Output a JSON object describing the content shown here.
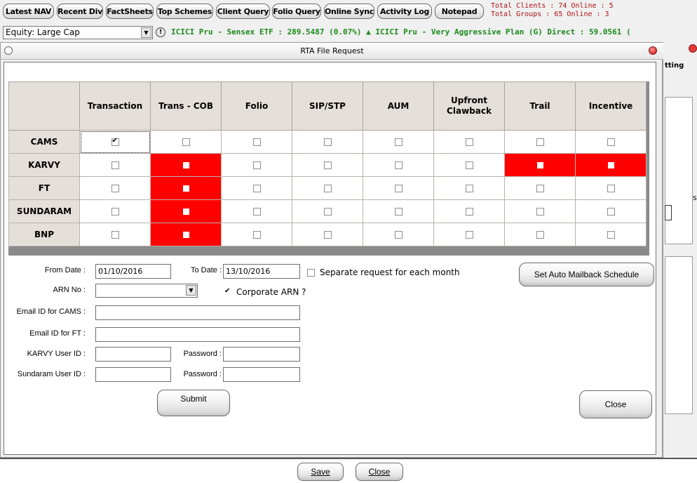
{
  "toolbar": {
    "buttons": [
      "Latest NAV",
      "Recent Div",
      "FactSheets",
      "Top Schemes",
      "Client Query",
      "Folio Query",
      "Online Sync",
      "Activity Log",
      "Notepad"
    ],
    "stats_line1": "Total Clients : 74 Online : 5",
    "stats_line2": "Total Groups : 65 Online : 3"
  },
  "category_select": {
    "value": "Equity: Large Cap"
  },
  "ticker": "ICICI Pru - Sensex ETF : 289.5487 (0.07%) ▲  ICICI Pru - Very Aggressive Plan (G) Direct : 59.0561 (",
  "dialog": {
    "title": "RTA File Request",
    "grid": {
      "columns": [
        "Transaction",
        "Trans - COB",
        "Folio",
        "SIP/STP",
        "AUM",
        "Upfront Clawback",
        "Trail",
        "Incentive"
      ],
      "rows": [
        {
          "name": "CAMS",
          "checked": [
            true,
            false,
            false,
            false,
            false,
            false,
            false,
            false
          ],
          "disabled": [
            false,
            false,
            false,
            false,
            false,
            false,
            false,
            false
          ]
        },
        {
          "name": "KARVY",
          "checked": [
            false,
            false,
            false,
            false,
            false,
            false,
            false,
            false
          ],
          "disabled": [
            false,
            true,
            false,
            false,
            false,
            false,
            true,
            true
          ]
        },
        {
          "name": "FT",
          "checked": [
            false,
            false,
            false,
            false,
            false,
            false,
            false,
            false
          ],
          "disabled": [
            false,
            true,
            false,
            false,
            false,
            false,
            false,
            false
          ]
        },
        {
          "name": "SUNDARAM",
          "checked": [
            false,
            false,
            false,
            false,
            false,
            false,
            false,
            false
          ],
          "disabled": [
            false,
            true,
            false,
            false,
            false,
            false,
            false,
            false
          ]
        },
        {
          "name": "BNP",
          "checked": [
            false,
            false,
            false,
            false,
            false,
            false,
            false,
            false
          ],
          "disabled": [
            false,
            true,
            false,
            false,
            false,
            false,
            false,
            false
          ]
        }
      ],
      "disabled_color": "#ff0000"
    },
    "form": {
      "from_date_label": "From Date :",
      "from_date": "01/10/2016",
      "to_date_label": "To Date :",
      "to_date": "13/10/2016",
      "separate_label": "Separate request for each month",
      "separate_checked": false,
      "arn_label": "ARN No :",
      "arn_value": "",
      "corporate_label": "Corporate ARN ?",
      "corporate_checked": true,
      "email_cams_label": "Email ID for CAMS :",
      "email_cams": "",
      "email_ft_label": "Email ID for FT :",
      "email_ft": "",
      "karvy_user_label": "KARVY User ID :",
      "karvy_user": "",
      "karvy_pass_label": "Password :",
      "karvy_pass": "",
      "sundaram_user_label": "Sundaram User ID :",
      "sundaram_user": "",
      "sundaram_pass_label": "Password :",
      "sundaram_pass": ""
    },
    "buttons": {
      "auto_mailback": "Set Auto Mailback Schedule",
      "submit": "Submit",
      "close": "Close"
    }
  },
  "right_panel": {
    "partial_label": "tting",
    "partial_char": "s"
  },
  "bottom": {
    "save": "Save",
    "close": "Close"
  },
  "colors": {
    "ticker": "#1a8a1a",
    "stats": "#b01010",
    "titlebar_close": "#e23b3b"
  }
}
